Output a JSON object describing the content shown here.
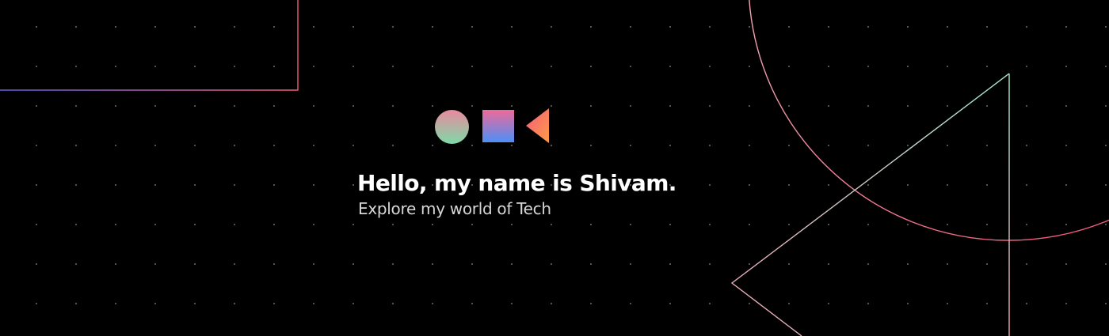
{
  "hero": {
    "headline": "Hello, my name is Shivam.",
    "subheadline": "Explore my world of Tech"
  },
  "logo_shapes": [
    {
      "icon": "circle-icon",
      "gradient": [
        "#e88a9e",
        "#7fd9a8"
      ]
    },
    {
      "icon": "square-icon",
      "gradient": [
        "#ee6a9a",
        "#4d8ff7"
      ]
    },
    {
      "icon": "triangle-icon",
      "gradient": [
        "#f35b7e",
        "#ff9c45"
      ]
    }
  ],
  "colors": {
    "background": "#000000",
    "dots": "#5a5a5a",
    "text_primary": "#ffffff",
    "text_secondary": "#d6d6d6",
    "line_pink": "#f45d7f",
    "line_mint": "#a6e9cd",
    "line_purple": "#6c62e6"
  }
}
